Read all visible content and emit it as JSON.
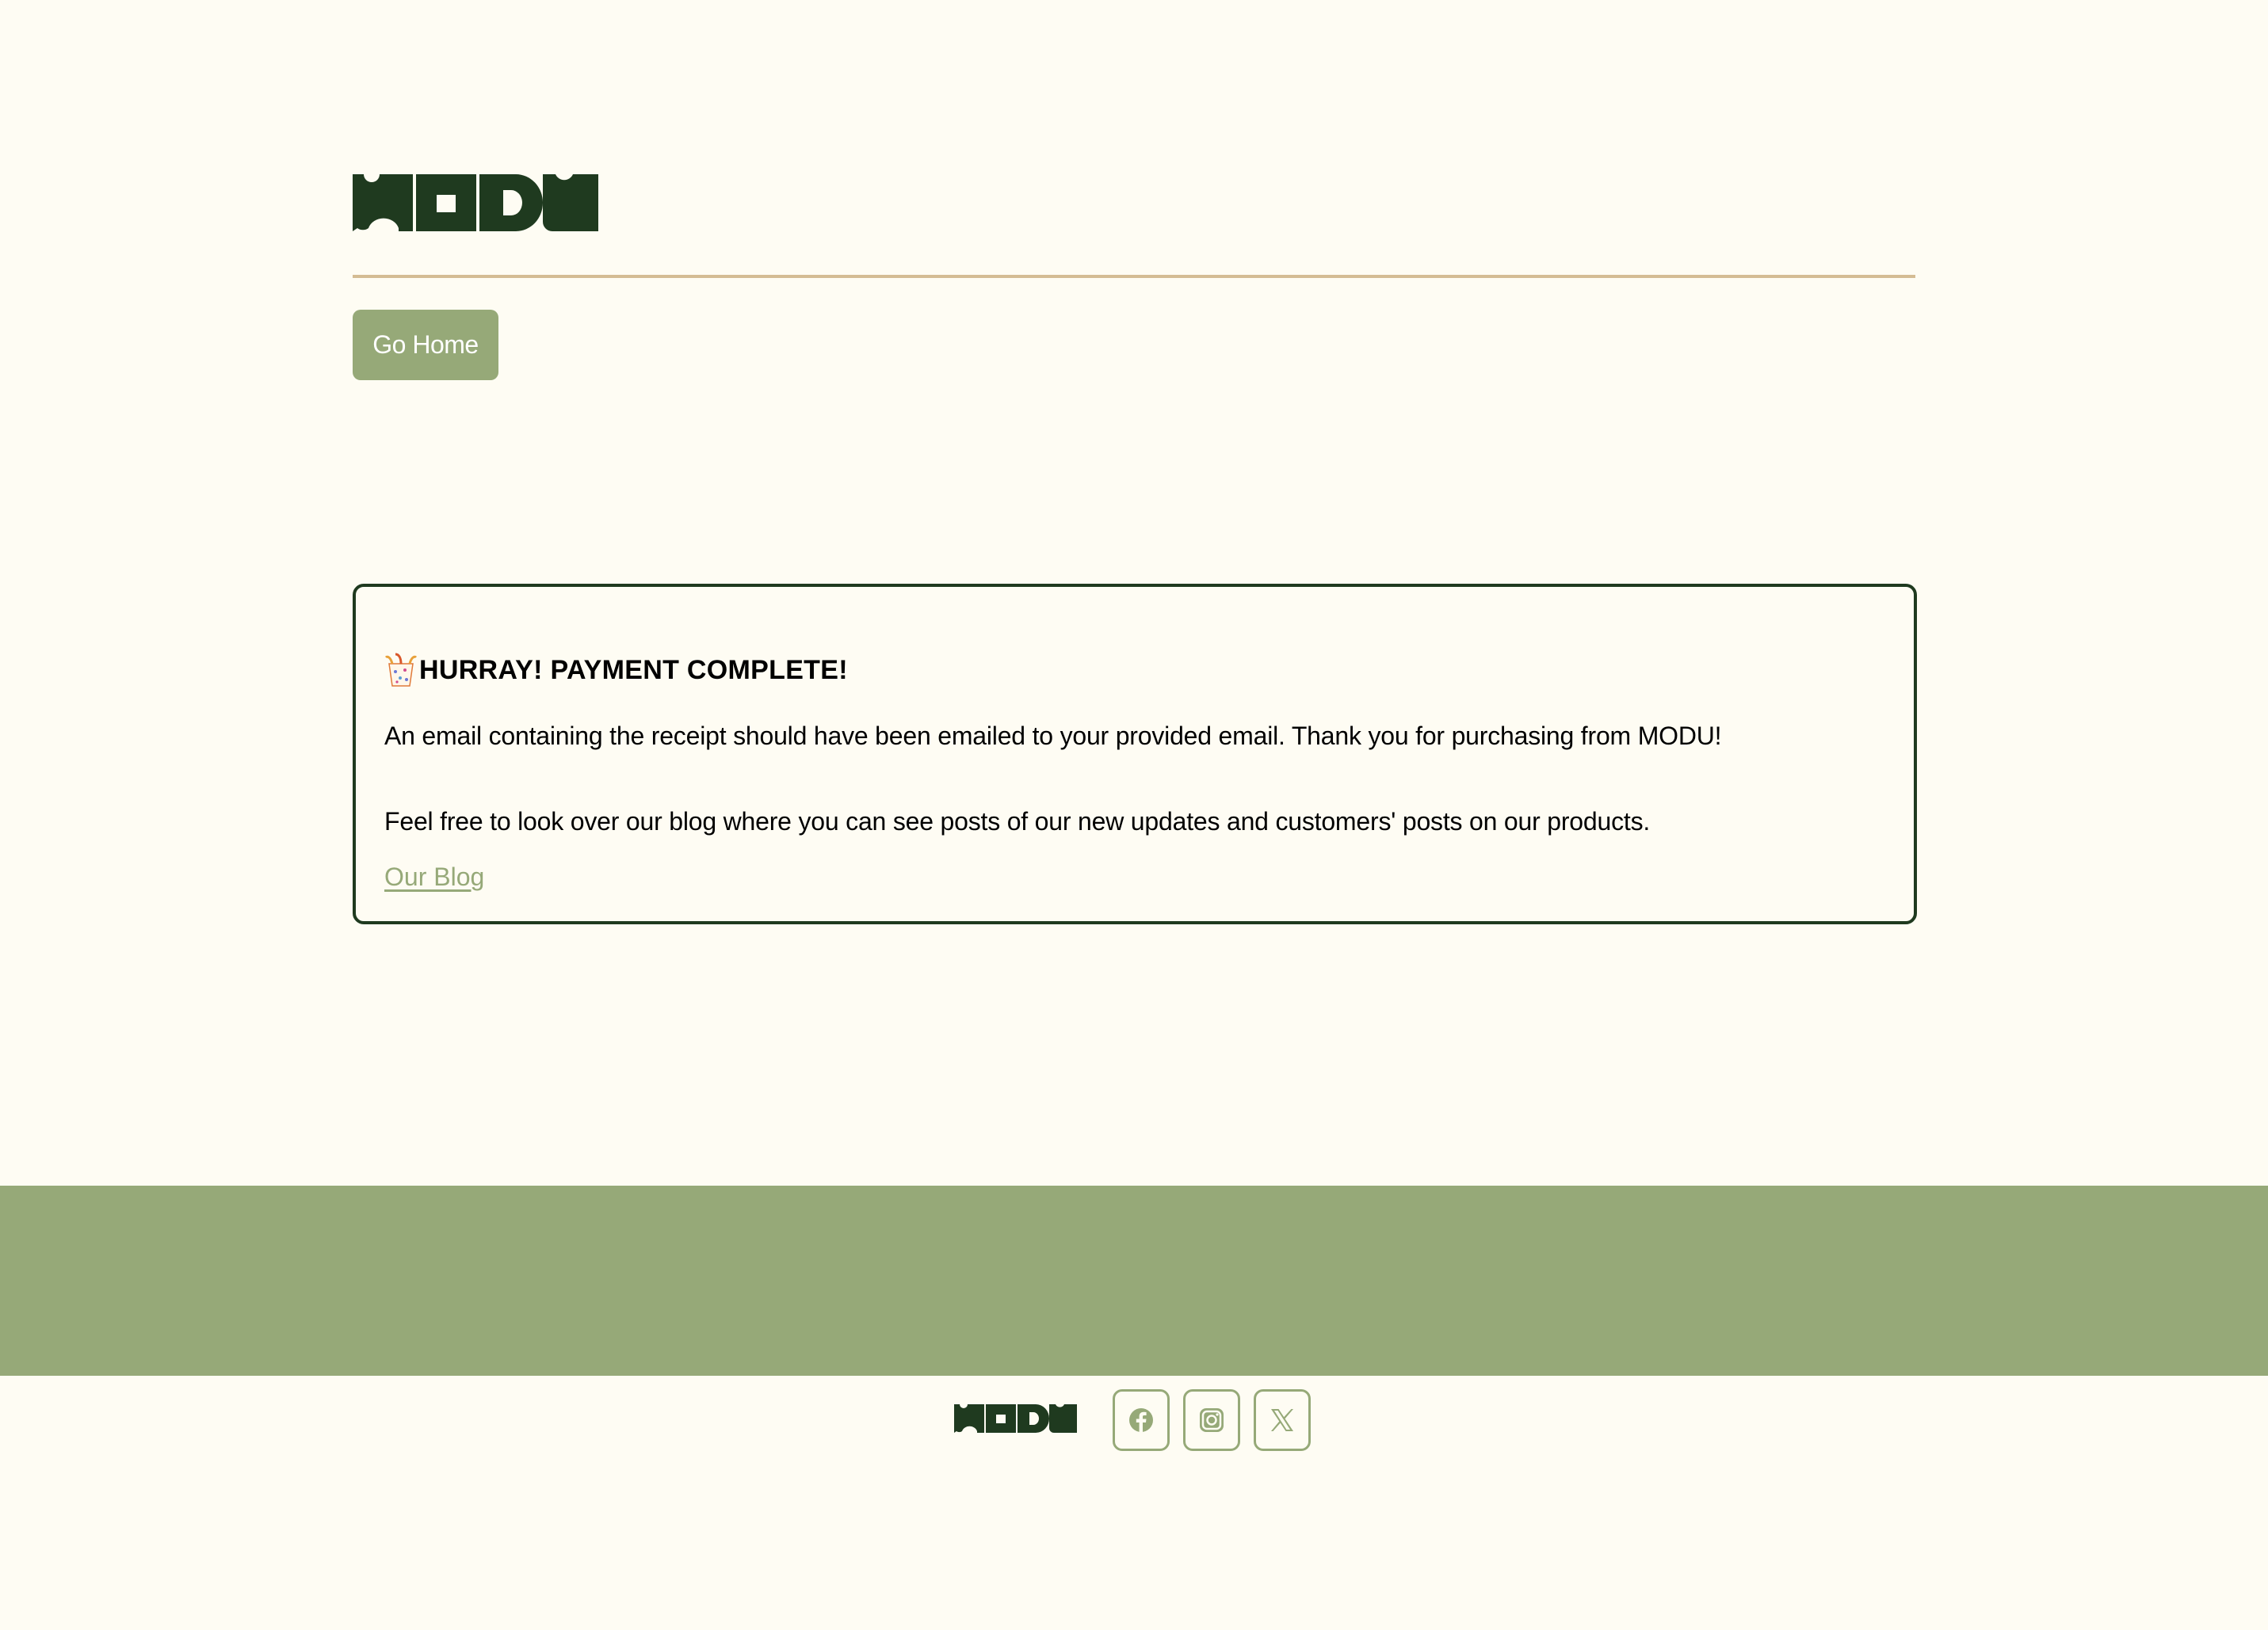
{
  "brand": {
    "logo_text": "MODU",
    "primary_color": "#96a978",
    "dark_color": "#1f3a1f",
    "rule_color": "#d4bc93",
    "background": "#fefcf3"
  },
  "nav": {
    "go_home_label": "Go Home"
  },
  "confirmation": {
    "icon": "confetti-icon",
    "title": "HURRAY! PAYMENT COMPLETE!",
    "message": "An email containing the receipt should have been emailed to your provided email. Thank you for purchasing from MODU!",
    "blog_prompt": "Feel free to look over our blog where you can see posts of our new updates and customers' posts on our products.",
    "blog_link_label": "Our Blog"
  },
  "footer": {
    "logo_text": "MODU",
    "social": [
      {
        "name": "facebook",
        "icon": "facebook-icon"
      },
      {
        "name": "instagram",
        "icon": "instagram-icon"
      },
      {
        "name": "x",
        "icon": "x-icon"
      }
    ]
  }
}
